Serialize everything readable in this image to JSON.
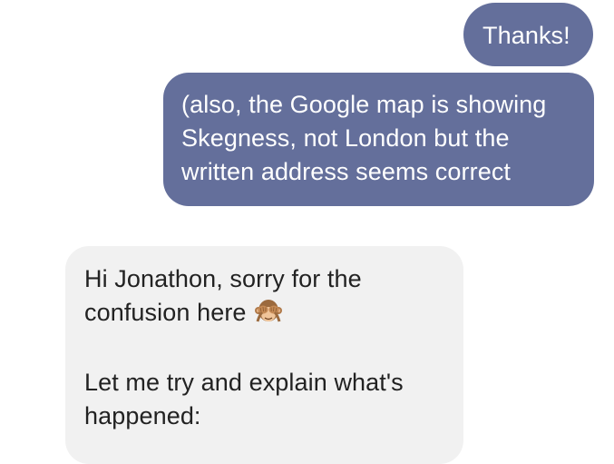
{
  "messages": [
    {
      "direction": "outgoing",
      "lines": [
        "Thanks!"
      ]
    },
    {
      "direction": "outgoing",
      "lines": [
        "(also, the Google map is showing",
        "Skegness, not London but the",
        "written address seems correct"
      ]
    },
    {
      "direction": "incoming",
      "paragraphs": [
        {
          "lines": [
            "Hi Jonathon, sorry for the",
            "confusion here"
          ],
          "trailing_icon": "see-no-evil-monkey-icon"
        },
        {
          "lines": [
            "Let me try and explain what's",
            "happened:"
          ]
        }
      ]
    }
  ],
  "colors": {
    "outgoing_bubble": "#646f9b",
    "incoming_bubble": "#f1f1f1",
    "outgoing_text": "#ffffff",
    "incoming_text": "#222222"
  }
}
